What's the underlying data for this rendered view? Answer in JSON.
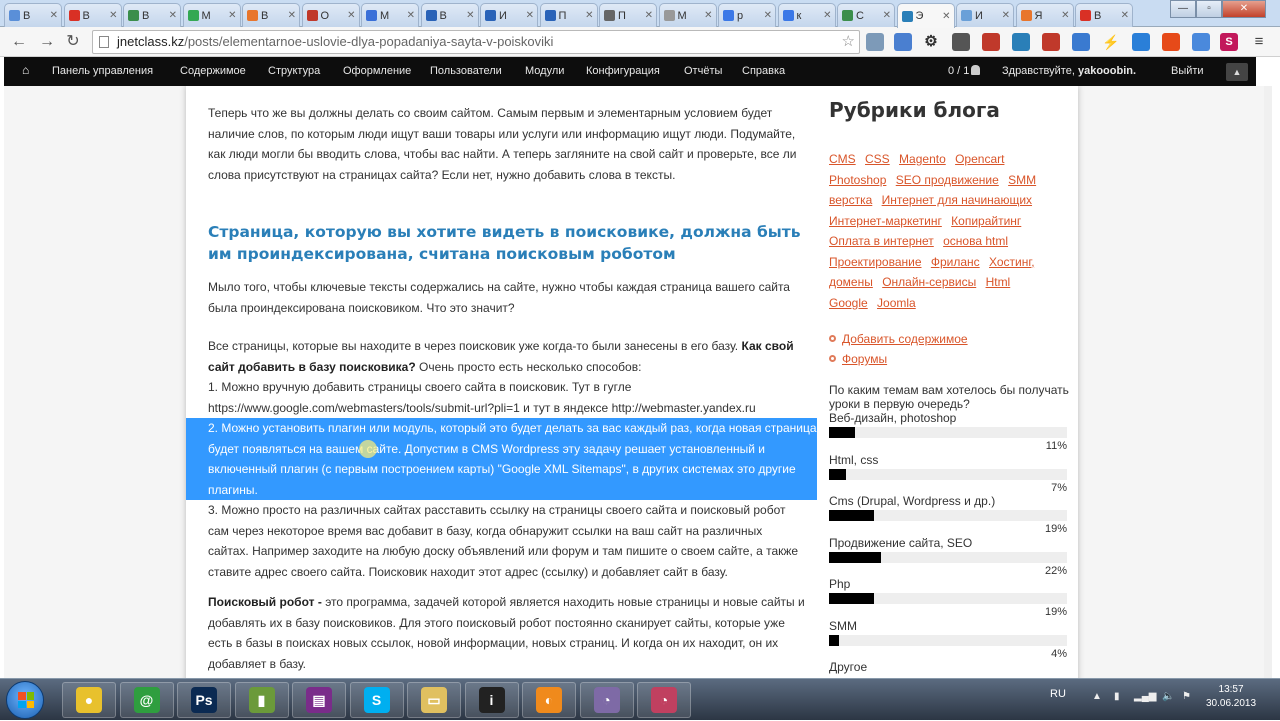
{
  "browser": {
    "tabs": [
      {
        "label": "В",
        "fav": "#5a8fd8"
      },
      {
        "label": "В",
        "fav": "#d93025"
      },
      {
        "label": "В",
        "fav": "#3b8e4b"
      },
      {
        "label": "М",
        "fav": "#34a853"
      },
      {
        "label": "В",
        "fav": "#e8762d"
      },
      {
        "label": "О",
        "fav": "#c0392b"
      },
      {
        "label": "М",
        "fav": "#3a6fd8"
      },
      {
        "label": "В",
        "fav": "#2a63b8"
      },
      {
        "label": "И",
        "fav": "#2a63b8"
      },
      {
        "label": "П",
        "fav": "#2a63b8"
      },
      {
        "label": "П",
        "fav": "#666666"
      },
      {
        "label": "М",
        "fav": "#999999"
      },
      {
        "label": "р",
        "fav": "#3b78e7"
      },
      {
        "label": "к",
        "fav": "#3b78e7"
      },
      {
        "label": "С",
        "fav": "#3b8e4b"
      },
      {
        "label": "Э",
        "fav": "#2a7fb8"
      },
      {
        "label": "И",
        "fav": "#6aa0d8"
      },
      {
        "label": "Я",
        "fav": "#e8762d"
      },
      {
        "label": "В",
        "fav": "#d93025"
      }
    ],
    "url_domain": "jnetclass.kz",
    "url_path": "/posts/elementarnoe-uslovie-dlya-popadaniya-sayta-v-poiskoviki",
    "nav": {
      "back": "←",
      "forward": "→",
      "reload": "↻"
    }
  },
  "adminbar": {
    "home": "⌂",
    "menu": [
      "Панель управления",
      "Содержимое",
      "Структура",
      "Оформление",
      "Пользователи",
      "Модули",
      "Конфигурация",
      "Отчёты",
      "Справка"
    ],
    "users_online": "0 / 1",
    "greeting_prefix": "Здравствуйте,",
    "username": "yakooobin.",
    "logout": "Выйти",
    "collapse": "▲"
  },
  "article": {
    "p1": "Теперь что же вы должны делать со своим сайтом. Самым первым и элементарным условием будет наличие слов, по которым люди ищут ваши товары или услуги или информацию ищут люди. Подумайте, как люди могли бы вводить слова, чтобы вас найти. А теперь загляните на свой сайт и проверьте, все ли слова присутствуют на страницах сайта? Если нет, нужно добавить слова в тексты.",
    "h2": "Страница, которую вы хотите видеть в поисковике, должна быть им проиндексирована, считана поисковым роботом",
    "p2": "Мыло того, чтобы ключевые тексты содержались на сайте, нужно чтобы каждая страница вашего сайта была проиндексирована поисковиком. Что это значит?",
    "p3_a": "Все страницы, которые вы находите в через поисковик уже когда-то были занесены в его базу.",
    "p3_b": "Как свой сайт добавить в базу поисковика?",
    "p3_c": "Очень просто есть несколько способов:",
    "item1_a": "1. Можно вручную добавить страницы своего сайта в поисковик. Тут в гугле",
    "item1_link1": "https://www.google.com/webmasters/tools/submit-url?pli=1",
    "item1_mid": "и тут в яндексе",
    "item1_link2": "http://webmaster.yandex.ru",
    "item2": "2. Можно установить плагин или модуль, который это будет делать за вас каждый раз, когда новая страница будет появляться на вашем сайте. Допустим в CMS Wordpress эту задачу решает установленный и включенный плагин (с первым построением карты) \"Google XML Sitemaps\", в других системах это другие плагины.",
    "item3": "3. Можно просто на различных сайтах расставить ссылку на страницы своего сайта и поисковый робот сам через некоторое время вас добавит в базу, когда обнаружит ссылки на ваш сайт на различных сайтах. Например заходите на любую доску объявлений или форум и там пишите о своем сайте, а также ставите адрес своего сайта. Поисковик находит этот адрес (ссылку) и добавляет сайт в базу.",
    "p4_b": "Поисковый робот -",
    "p4": "это программа, задачей которой является находить новые страницы и новые сайты и добавлять их в базу поисковиков. Для этого поисковый робот постоянно сканирует сайты, которые уже есть в базы в поисках новых ссылок, новой информации, новых страниц. И когда он их находит, он их добавляет в базу."
  },
  "sidebar": {
    "title": "Рубрики блога",
    "tags": [
      "CMS",
      "CSS",
      "Magento",
      "Opencart",
      "Photoshop",
      "SEO продвижение",
      "SMM",
      "верстка",
      "Интернет для начинающих",
      "Интернет-маркетинг",
      "Копирайтинг",
      "Оплата в интернет",
      "основа html",
      "Проектирование",
      "Фриланс",
      "Хостинг, домены",
      "Онлайн-сервисы",
      "Html",
      "Google",
      "Joomla"
    ],
    "links": [
      "Добавить содержимое",
      "Форумы"
    ],
    "poll_question": "По каким темам вам хотелось бы получать уроки в первую очередь?",
    "poll": [
      {
        "label": "Веб-дизайн, photoshop",
        "pct_text": "11%",
        "pct": 11
      },
      {
        "label": "Html, css",
        "pct_text": "7%",
        "pct": 7
      },
      {
        "label": "Cms (Drupal, Wordpress и др.)",
        "pct_text": "19%",
        "pct": 19
      },
      {
        "label": "Продвижение сайта, SEO",
        "pct_text": "22%",
        "pct": 22
      },
      {
        "label": "Php",
        "pct_text": "19%",
        "pct": 19
      },
      {
        "label": "SMM",
        "pct_text": "4%",
        "pct": 4
      },
      {
        "label": "Другое",
        "pct_text": "",
        "pct": 0
      }
    ]
  },
  "taskbar": {
    "apps": [
      {
        "name": "chrome",
        "glyph": "●",
        "color": "#e8c12d"
      },
      {
        "name": "mail",
        "glyph": "@",
        "color": "#2f9e3f"
      },
      {
        "name": "photoshop",
        "glyph": "Ps",
        "color": "#0b2a52"
      },
      {
        "name": "installer",
        "glyph": "▮",
        "color": "#6b9a3a"
      },
      {
        "name": "winrar",
        "glyph": "▤",
        "color": "#7a2c8a"
      },
      {
        "name": "skype",
        "glyph": "S",
        "color": "#00aff0"
      },
      {
        "name": "explorer",
        "glyph": "▭",
        "color": "#e0c060"
      },
      {
        "name": "info",
        "glyph": "i",
        "color": "#222222"
      },
      {
        "name": "firefox",
        "glyph": "◐",
        "color": "#f08a1c"
      },
      {
        "name": "gauge1",
        "glyph": "◔",
        "color": "#7e6aa6"
      },
      {
        "name": "gauge2",
        "glyph": "◔",
        "color": "#c04060"
      }
    ],
    "lang": "RU",
    "time": "13:57",
    "date": "30.06.2013"
  }
}
